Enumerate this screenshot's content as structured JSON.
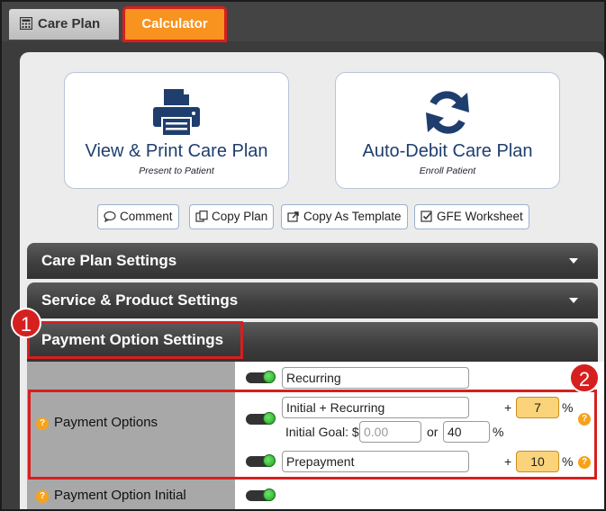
{
  "tabs": {
    "care_plan": "Care Plan",
    "calculator": "Calculator"
  },
  "actions": {
    "print": {
      "title": "View & Print Care Plan",
      "subtitle": "Present to Patient",
      "icon": "printer-icon"
    },
    "debit": {
      "title": "Auto-Debit Care Plan",
      "subtitle": "Enroll Patient",
      "icon": "refresh-icon"
    }
  },
  "toolbar": {
    "comment": "Comment",
    "copy_plan": "Copy Plan",
    "copy_template": "Copy As Template",
    "gfe": "GFE Worksheet"
  },
  "sections": {
    "care_plan_settings": "Care Plan Settings",
    "service_product_settings": "Service & Product Settings",
    "payment_option_settings": "Payment Option Settings"
  },
  "badges": {
    "one": "1",
    "two": "2"
  },
  "payment": {
    "label": "Payment Options",
    "initial_label": "Payment Option Initial",
    "recurring": "Recurring",
    "initial_recurring": "Initial + Recurring",
    "initial_goal_label": "Initial Goal: $",
    "initial_goal_placeholder": "0.00",
    "or": "or",
    "initial_goal_pct": "40",
    "pct_sign": "%",
    "plus": "+",
    "initial_recurring_pct": "7",
    "prepayment": "Prepayment",
    "prepayment_pct": "10",
    "help": "?"
  },
  "colors": {
    "accent_orange": "#f7931e",
    "highlight_red": "#d61f1f",
    "brand_navy": "#1f3e6e",
    "toggle_green": "#1fa51f"
  }
}
